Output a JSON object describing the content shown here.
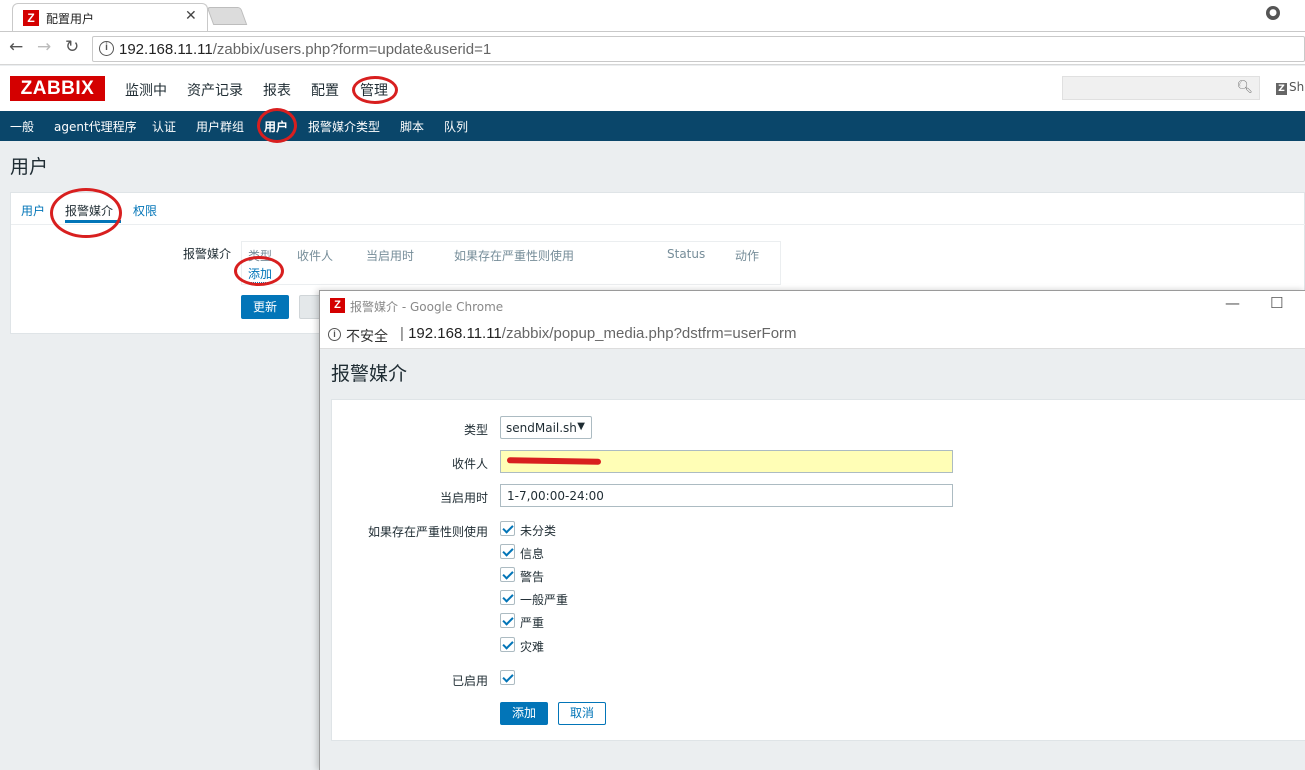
{
  "browser": {
    "tab_title": "配置用户",
    "tab_favicon": "Z",
    "url_prefix": "192.168.11.11",
    "url_path": "/zabbix/users.php?form=update&userid=1"
  },
  "zabbix": {
    "logo": "ZABBIX",
    "menu": [
      "监测中",
      "资产记录",
      "报表",
      "配置",
      "管理"
    ],
    "share": "Sh",
    "submenu": [
      "一般",
      "agent代理程序",
      "认证",
      "用户群组",
      "用户",
      "报警媒介类型",
      "脚本",
      "队列"
    ]
  },
  "page": {
    "title": "用户",
    "tabs": [
      "用户",
      "报警媒介",
      "权限"
    ],
    "media_label": "报警媒介",
    "media_columns": [
      "类型",
      "收件人",
      "当启用时",
      "如果存在严重性则使用",
      "Status",
      "动作"
    ],
    "add_link": "添加",
    "update_button": "更新"
  },
  "popup": {
    "window_title": "报警媒介 - Google Chrome",
    "insecure_label": "不安全",
    "url_prefix": "192.168.11.11",
    "url_path": "/zabbix/popup_media.php?dstfrm=userForm",
    "heading": "报警媒介",
    "type_label": "类型",
    "type_value": "sendMail.sh",
    "recipient_label": "收件人",
    "when_label": "当启用时",
    "when_value": "1-7,00:00-24:00",
    "severity_label": "如果存在严重性则使用",
    "severities": [
      "未分类",
      "信息",
      "警告",
      "一般严重",
      "严重",
      "灾难"
    ],
    "enabled_label": "已启用",
    "add_button": "添加",
    "cancel_button": "取消"
  },
  "colors": {
    "zabbix_red": "#d40000",
    "nav_blue": "#0a466a",
    "link_blue": "#0275b8",
    "annotation_red": "#d81f1f"
  }
}
